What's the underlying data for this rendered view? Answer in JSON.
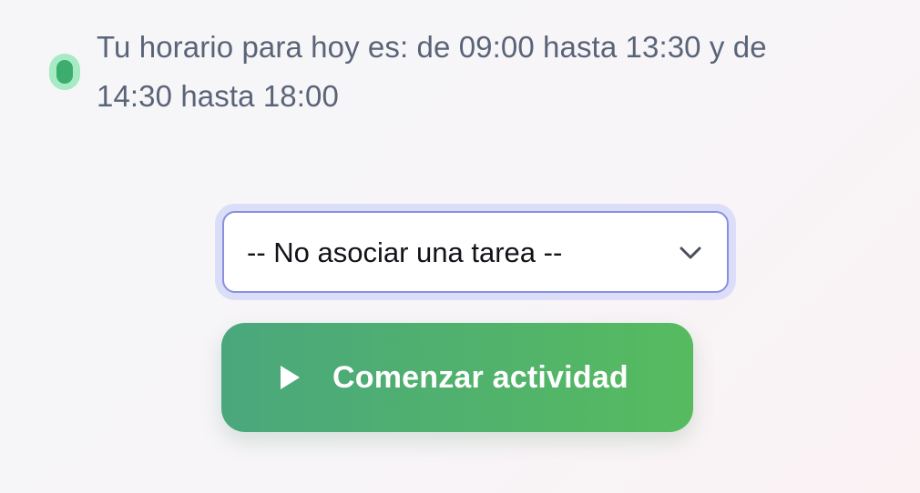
{
  "schedule": {
    "status_color": "#3cad6d",
    "line1": "Tu horario para hoy es: de 09:00 hasta 13:30 y de",
    "line2": "14:30 hasta 18:00"
  },
  "task_select": {
    "selected_value": "-- No asociar una tarea --",
    "icon": "chevron-down-icon"
  },
  "start_button": {
    "icon": "play-icon",
    "label": "Comenzar actividad",
    "gradient_start": "#4aa77d",
    "gradient_end": "#56bb5f"
  }
}
